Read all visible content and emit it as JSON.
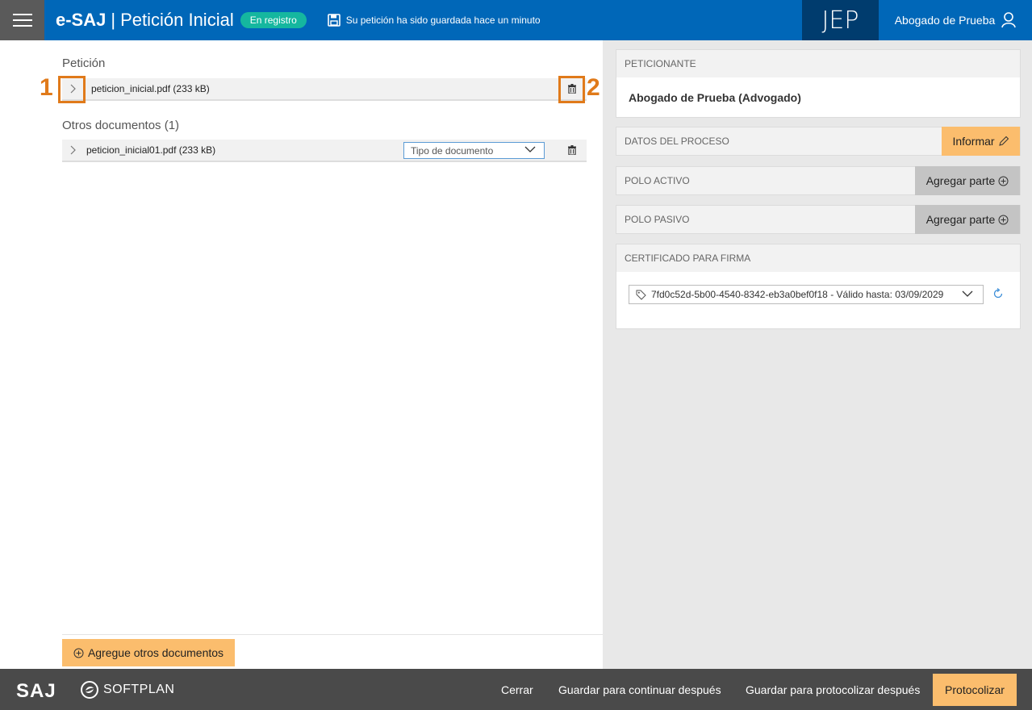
{
  "header": {
    "brand": "e-SAJ",
    "separator": "|",
    "title": "Petición Inicial",
    "status": "En registro",
    "saved_message": "Su petición ha sido guardada hace un minuto",
    "org": "JEP",
    "user": "Abogado de Prueba"
  },
  "left": {
    "peticion_label": "Petición",
    "peticion_file": "peticion_inicial.pdf (233 kB)",
    "marker1": "1",
    "marker2": "2",
    "otros_label": "Otros documentos (1)",
    "otros_file": "peticion_inicial01.pdf (233 kB)",
    "tipo_placeholder": "Tipo de documento",
    "add_docs": "Agregue otros documentos"
  },
  "right": {
    "peticionante_head": "PETICIONANTE",
    "peticionante_value": "Abogado de Prueba (Advogado)",
    "datos_head": "DATOS DEL PROCESO",
    "informar": "Informar",
    "polo_activo_head": "POLO ACTIVO",
    "polo_pasivo_head": "POLO PASIVO",
    "agregar_parte": "Agregar parte",
    "cert_head": "CERTIFICADO PARA FIRMA",
    "cert_value": "7fd0c52d-5b00-4540-8342-eb3a0bef0f18 - Válido hasta: 03/09/2029"
  },
  "footer": {
    "saj": "SAJ",
    "softplan": "SOFTPLAN",
    "cerrar": "Cerrar",
    "guardar_continuar": "Guardar para continuar después",
    "guardar_protocolizar": "Guardar para protocolizar después",
    "protocolizar": "Protocolizar"
  },
  "colors": {
    "header_blue": "#0067b8",
    "accent_orange": "#fbbd6d",
    "status_green": "#15b79f",
    "marker_orange": "#e07a1a"
  }
}
